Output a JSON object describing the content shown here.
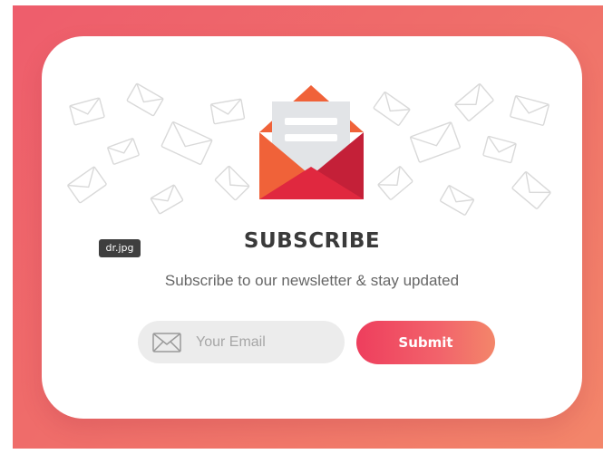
{
  "tooltip": {
    "text": "dr.jpg"
  },
  "hero": {
    "icon": "open-envelope-icon"
  },
  "heading": {
    "title": "SUBSCRIBE",
    "subtitle": "Subscribe to our newsletter & stay updated"
  },
  "form": {
    "email_placeholder": "Your Email",
    "email_value": "",
    "email_icon": "envelope-icon",
    "submit_label": "Submit"
  },
  "colors": {
    "background_start": "#ee5d6c",
    "background_end": "#f3866a",
    "accent": "#ee3e5d",
    "envelope_body": "#e0283f",
    "envelope_flap": "#f06239",
    "letter": "#e2e4e7"
  }
}
